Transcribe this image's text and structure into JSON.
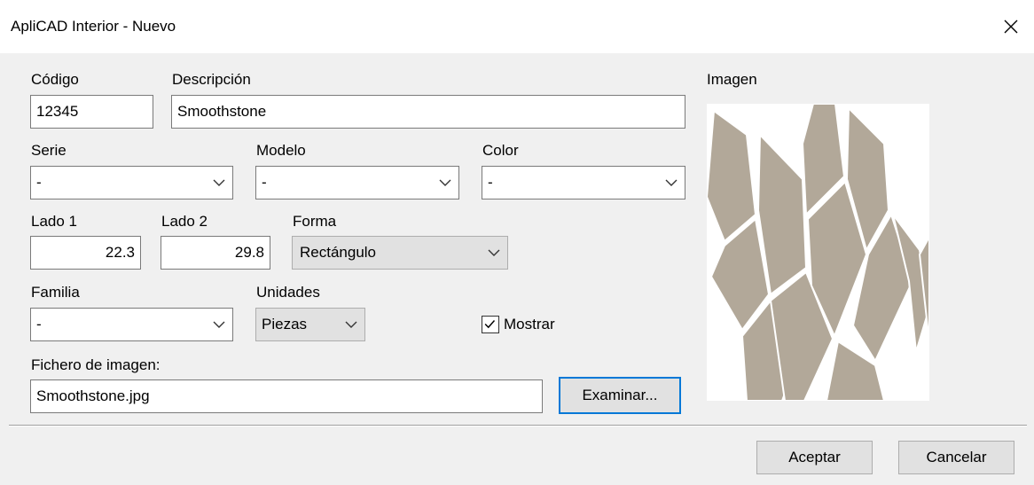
{
  "window": {
    "title": "ApliCAD Interior - Nuevo"
  },
  "form": {
    "codigo": {
      "label": "Código",
      "value": "12345"
    },
    "descripcion": {
      "label": "Descripción",
      "value": "Smoothstone"
    },
    "serie": {
      "label": "Serie",
      "value": "-"
    },
    "modelo": {
      "label": "Modelo",
      "value": "-"
    },
    "color": {
      "label": "Color",
      "value": "-"
    },
    "lado1": {
      "label": "Lado 1",
      "value": "22.3"
    },
    "lado2": {
      "label": "Lado 2",
      "value": "29.8"
    },
    "forma": {
      "label": "Forma",
      "value": "Rectángulo"
    },
    "familia": {
      "label": "Familia",
      "value": "-"
    },
    "unidades": {
      "label": "Unidades",
      "value": "Piezas"
    },
    "mostrar": {
      "label": "Mostrar",
      "checked": true
    },
    "fichero": {
      "label": "Fichero de imagen:",
      "value": "Smoothstone.jpg"
    },
    "examinar_label": "Examinar..."
  },
  "image_panel": {
    "label": "Imagen",
    "tile_color": "#b2a899"
  },
  "footer": {
    "accept_label": "Aceptar",
    "cancel_label": "Cancelar"
  }
}
